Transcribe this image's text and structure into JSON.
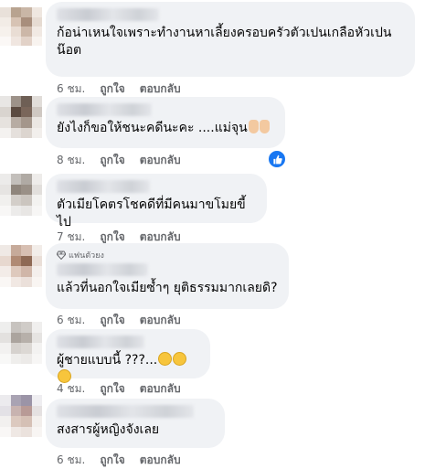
{
  "comments": [
    {
      "text_line1": "ก้อน่าเหนใจเพราะทำงานหาเลี้ยงครอบครัวตัวเปนเกลือหัวเปน",
      "text_line2": "น๊อต",
      "time": "6 ชม.",
      "like": "ถูกใจ",
      "reply": "ตอบกลับ"
    },
    {
      "text": "ยังไงก็ขอให้ชนะคดีนะคะ ....แม่จุน",
      "time": "8 ชม.",
      "like": "ถูกใจ",
      "reply": "ตอบกลับ",
      "reaction": "like-icon"
    },
    {
      "text": "ตัวเมียโคตรโชคดีที่มีคนมาขโมยขี้ไป",
      "time": "7 ชม.",
      "like": "ถูกใจ",
      "reply": "ตอบกลับ"
    },
    {
      "badge": "แฟนตัวยง",
      "text": "แล้วที่นอกใจเมียซ้ำๆ ยุติธรรมมากเลยดิ?",
      "time": "6 ชม.",
      "like": "ถูกใจ",
      "reply": "ตอบกลับ"
    },
    {
      "text": "ผู้ชายแบบนี้ ???...",
      "time": "4 ชม.",
      "like": "ถูกใจ",
      "reply": "ตอบกลับ"
    },
    {
      "text": "สงสารผู้หญิงจังเลย",
      "time": "6 ชม.",
      "like": "ถูกใจ",
      "reply": "ตอบกลับ"
    }
  ],
  "colors": {
    "bubble": "#f0f2f5",
    "meta_text": "#65676b",
    "like_blue": "#1877f2"
  }
}
